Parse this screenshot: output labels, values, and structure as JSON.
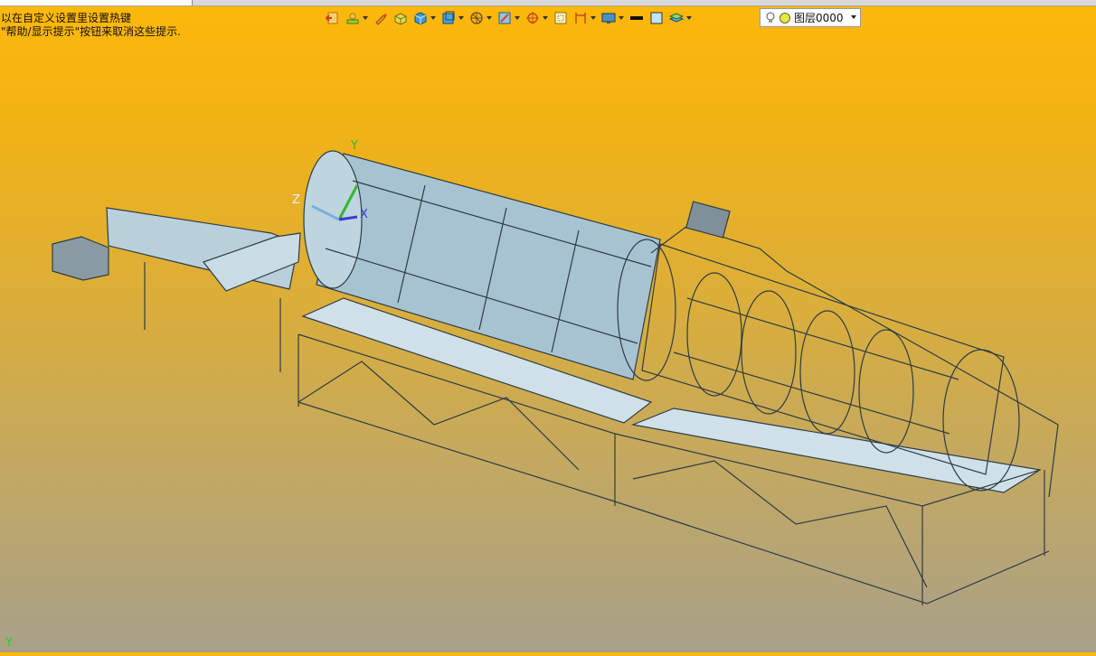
{
  "top_tab": {
    "title": ""
  },
  "hints": {
    "line1": "以在自定义设置里设置热键",
    "line2": "\"帮助/显示提示\"按钮来取消这些提示."
  },
  "toolbar": {
    "icons": [
      "exit-sketch-icon",
      "sketch-paint-icon",
      "pencil-icon",
      "solid-box-icon",
      "shaded-cube-icon",
      "view-cube-icon",
      "render-mode-icon",
      "section-view-icon",
      "snap-target-icon",
      "frame-icon",
      "dimension-icon",
      "display-settings-icon",
      "line-color-icon",
      "fill-color-icon",
      "layer-stack-icon"
    ]
  },
  "layer_selector": {
    "value": "图层0000"
  },
  "triad": {
    "x_label": "X",
    "y_label": "Y",
    "z_label": "Z"
  },
  "corner_axis": {
    "label": "Y"
  },
  "colors": {
    "bg_top": "#fdb80a",
    "bg_bottom": "#a8a089",
    "model_fill": "#a7c3d2",
    "model_edge": "#2a3a44",
    "corner_axis": "#1bd61b"
  }
}
